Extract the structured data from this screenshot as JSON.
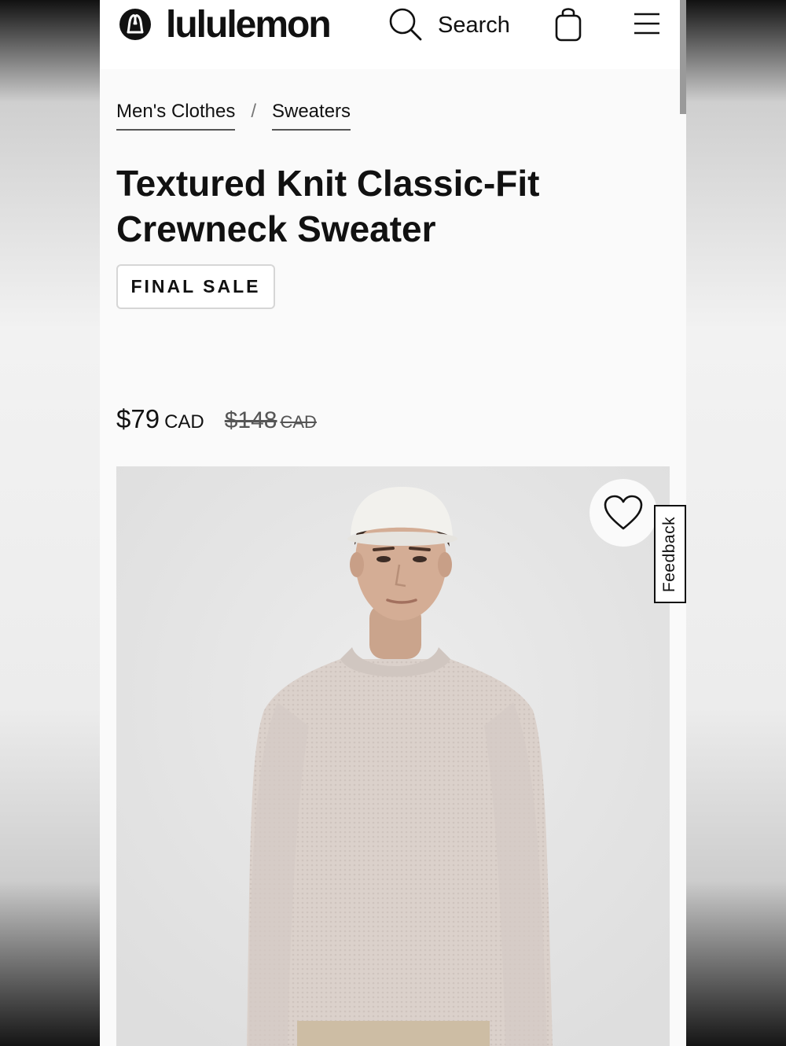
{
  "header": {
    "brand_name": "lululemon",
    "search_label": "Search",
    "icons": [
      "lululemon-logo-icon",
      "search-icon",
      "shopping-bag-icon",
      "hamburger-menu-icon"
    ]
  },
  "breadcrumb": {
    "items": [
      "Men's Clothes",
      "Sweaters"
    ],
    "separator": "/"
  },
  "product": {
    "title": "Textured Knit Classic-Fit Crewneck Sweater",
    "badge": "FINAL SALE",
    "price": "$79",
    "price_currency": "CAD",
    "original_price": "$148",
    "original_currency": "CAD",
    "image_icons": [
      "heart-icon"
    ]
  },
  "feedback": {
    "label": "Feedback"
  },
  "colors": {
    "text": "#111111",
    "page_background": "#fafafa",
    "image_background": "#e7e7e7",
    "sweater": "#d9cfc9",
    "cap": "#f2f1ed"
  }
}
